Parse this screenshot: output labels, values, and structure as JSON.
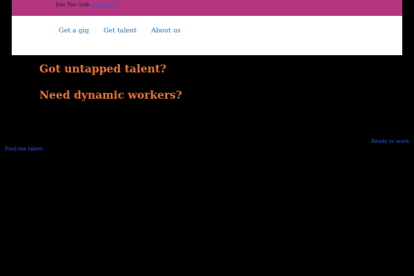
{
  "topbar": {
    "text": "Join The Guth",
    "link_label": "Bepay Job"
  },
  "nav": {
    "items": [
      {
        "label": "Get a gig"
      },
      {
        "label": "Get talent"
      },
      {
        "label": "About us"
      }
    ]
  },
  "hero": {
    "headline_1": "Got untapped talent?",
    "headline_2": "Need dynamic workers?"
  },
  "links": {
    "ready": "Ready to work",
    "find": "Find me talent"
  },
  "colors": {
    "topbar": "#b2357f",
    "header": "#ffffff",
    "background": "#000000",
    "headline": "#e8732e",
    "link": "#1f6dbf"
  }
}
